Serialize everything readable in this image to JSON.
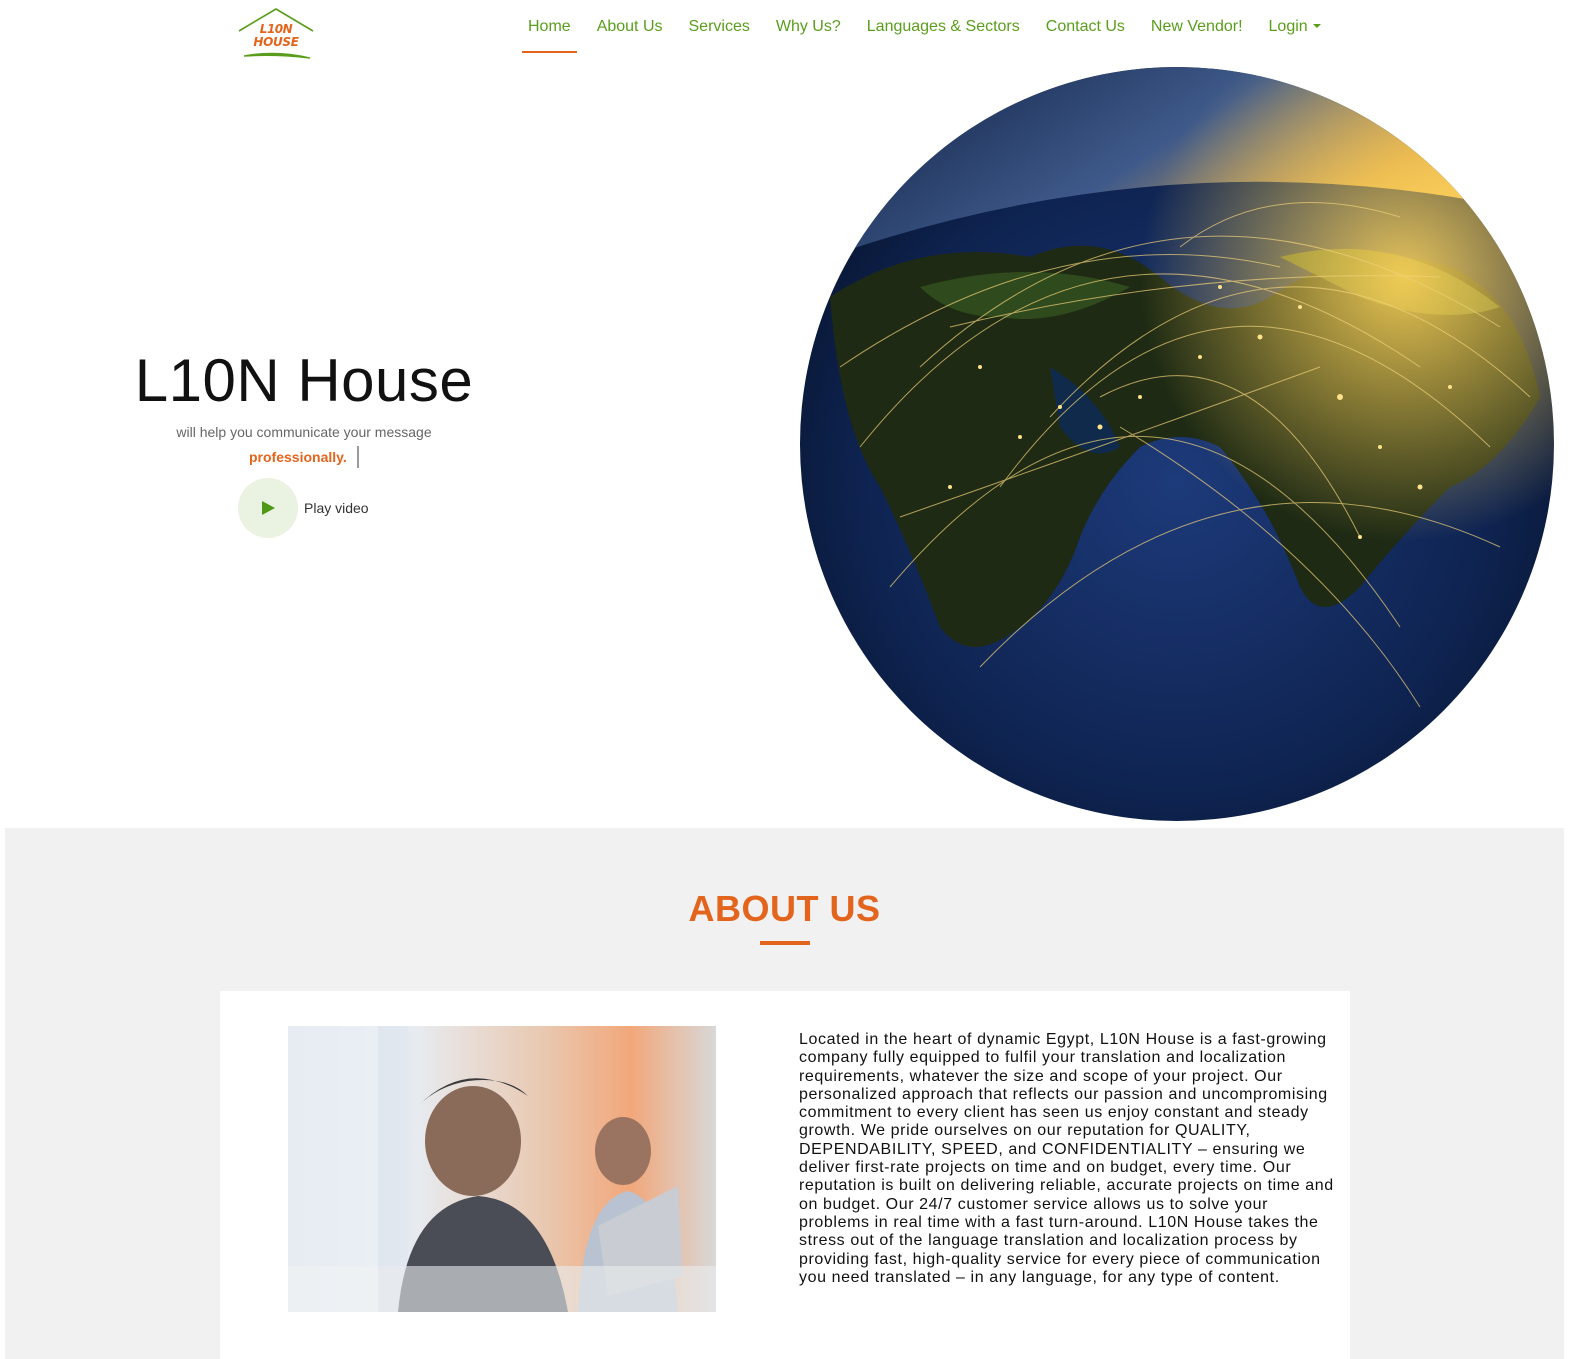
{
  "brand": {
    "logo_line1": "L10N",
    "logo_line2": "HOUSE",
    "colors": {
      "primary_green": "#5a9d1c",
      "accent_orange": "#e3651d",
      "section_bg": "#f1f1f1"
    }
  },
  "nav": {
    "items": [
      {
        "label": "Home",
        "active": true
      },
      {
        "label": "About Us"
      },
      {
        "label": "Services"
      },
      {
        "label": "Why Us?"
      },
      {
        "label": "Languages & Sectors"
      },
      {
        "label": "Contact Us"
      },
      {
        "label": "New Vendor!"
      },
      {
        "label": "Login",
        "dropdown": true,
        "icon": "caret-down-icon"
      }
    ]
  },
  "hero": {
    "title": "L10N House",
    "subtitle": "will help you communicate your message",
    "typed_word": "professionally.",
    "play_label": "Play video",
    "play_icon": "play-icon",
    "image": "earth-network-globe"
  },
  "about": {
    "heading": "ABOUT US",
    "image": "office-workers-photo",
    "body": "Located in the heart of dynamic Egypt, L10N House is a fast-growing company fully equipped to fulfil your translation and localization requirements, whatever the size and scope of your project. Our personalized approach that reflects our passion and uncompromising commitment to every client has seen us enjoy constant and steady growth. We pride ourselves on our reputation for QUALITY, DEPENDABILITY, SPEED, and CONFIDENTIALITY – ensuring we deliver first-rate projects on time and on budget, every time. Our reputation is built on delivering reliable, accurate projects on time and on budget. Our 24/7 customer service allows us to solve your problems in real time with a fast turn-around. L10N House takes the stress out of the language translation and localization process by providing fast, high-quality service for every piece of communication you need translated – in any language, for any type of content."
  }
}
